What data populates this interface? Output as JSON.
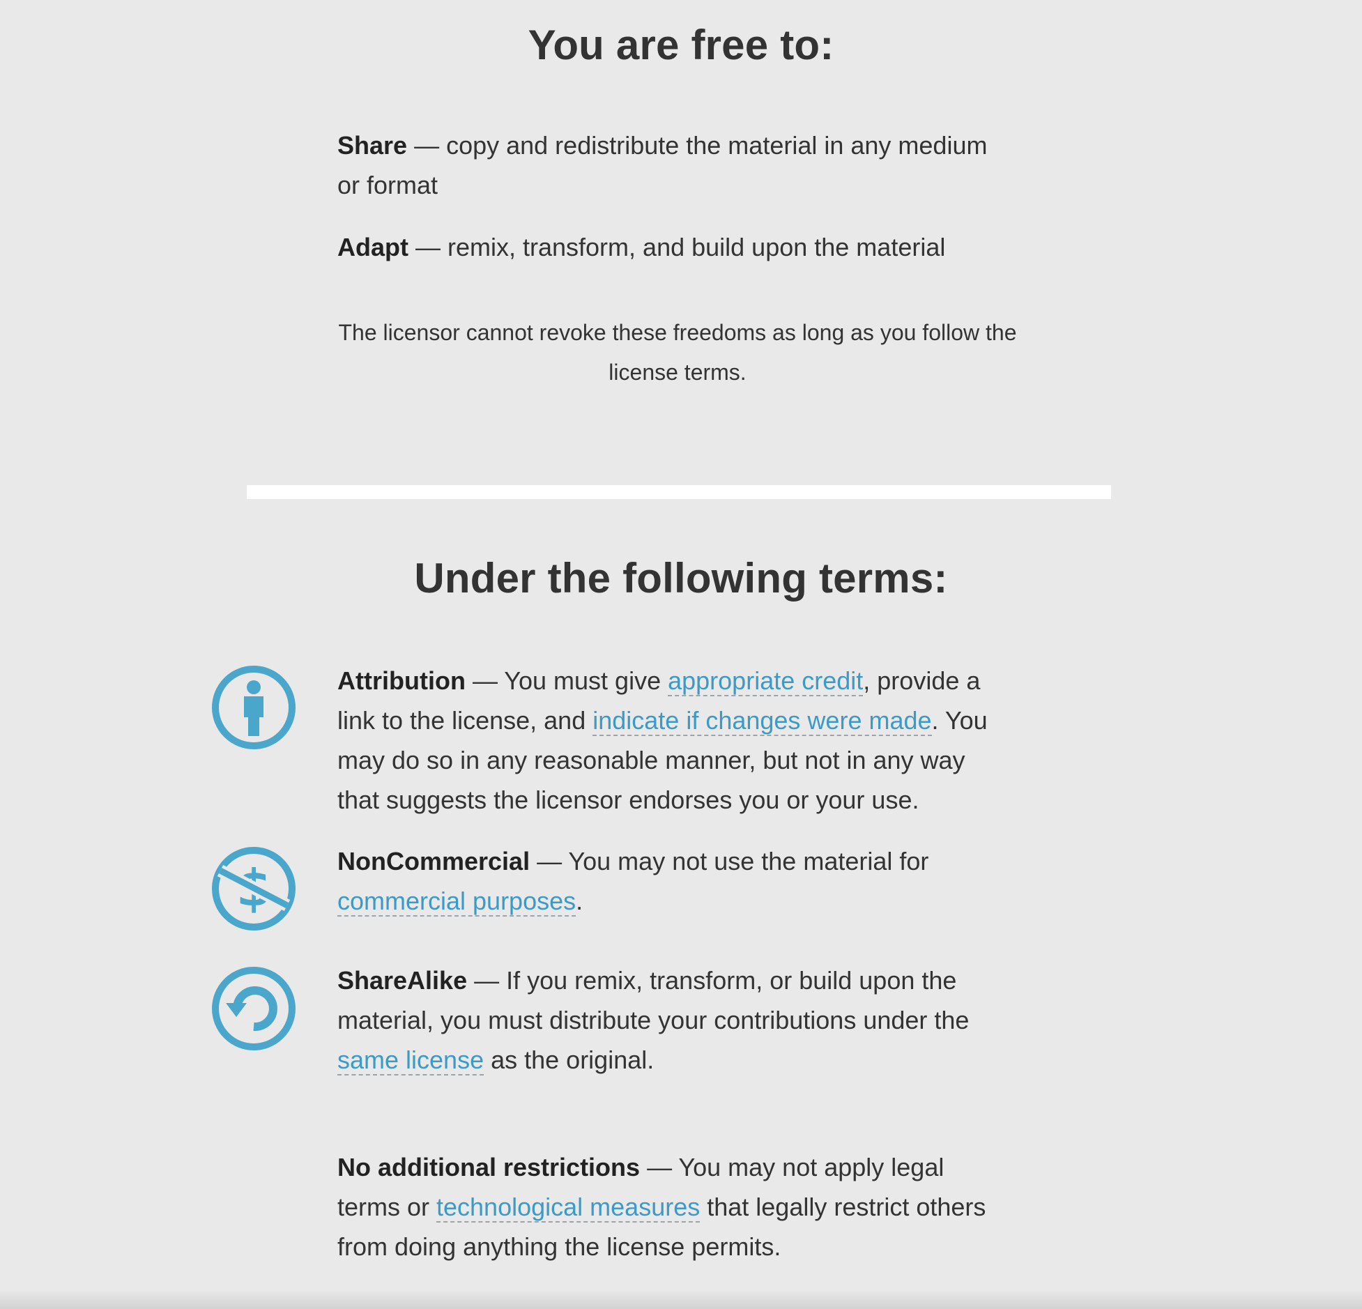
{
  "free_section": {
    "heading": "You are free to:",
    "share": {
      "term": "Share",
      "text": " — copy and redistribute the material in any medium or format"
    },
    "adapt": {
      "term": "Adapt",
      "text": " — remix, transform, and build upon the material"
    },
    "notice": "The licensor cannot revoke these freedoms as long as you follow the license terms."
  },
  "terms_section": {
    "heading": "Under the following terms:",
    "attribution": {
      "icon": "attribution-icon",
      "term": "Attribution",
      "text_1": " — You must give ",
      "link_1": "appropriate credit",
      "text_2": ", provide a link to the license, and ",
      "link_2": "indicate if changes were made",
      "text_3": ". You may do so in any reasonable manner, but not in any way that suggests the licensor endorses you or your use."
    },
    "noncommercial": {
      "icon": "noncommercial-icon",
      "term": "NonCommercial",
      "text_1": " — You may not use the material for ",
      "link_1": "commercial purposes",
      "text_2": "."
    },
    "sharealike": {
      "icon": "sharealike-icon",
      "term": "ShareAlike",
      "text_1": " — If you remix, transform, or build upon the material, you must distribute your contributions under the ",
      "link_1": "same license",
      "text_2": " as the original."
    },
    "no_restrictions": {
      "term": "No additional restrictions",
      "text_1": " — You may not apply legal terms or ",
      "link_1": "technological measures",
      "text_2": " that legally restrict others from doing anything the license permits."
    }
  },
  "colors": {
    "background": "#e9e9e9",
    "text": "#333333",
    "link": "#3c9ac8",
    "icon": "#4ba6cc",
    "divider": "#ffffff"
  }
}
